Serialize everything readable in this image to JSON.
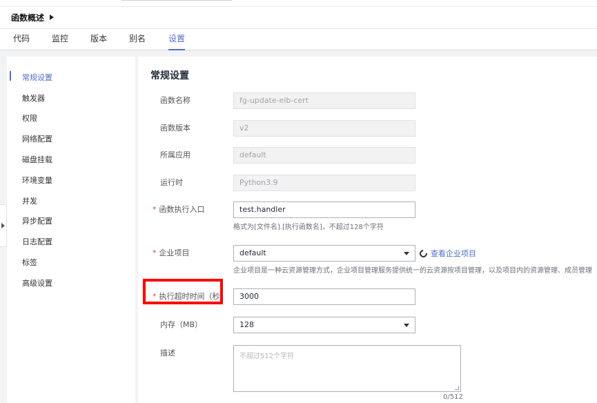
{
  "breadcrumb": {
    "title": "函数概述"
  },
  "tabs": [
    {
      "label": "代码"
    },
    {
      "label": "监控"
    },
    {
      "label": "版本"
    },
    {
      "label": "别名"
    },
    {
      "label": "设置"
    }
  ],
  "sidebar": {
    "items": [
      {
        "label": "常规设置"
      },
      {
        "label": "触发器"
      },
      {
        "label": "权限"
      },
      {
        "label": "网络配置"
      },
      {
        "label": "磁盘挂载"
      },
      {
        "label": "环境变量"
      },
      {
        "label": "并发"
      },
      {
        "label": "异步配置"
      },
      {
        "label": "日志配置"
      },
      {
        "label": "标签"
      },
      {
        "label": "高级设置"
      }
    ]
  },
  "section": {
    "title": "常规设置"
  },
  "form": {
    "function_name": {
      "label": "函数名称",
      "value": "fg-update-elb-cert"
    },
    "function_version": {
      "label": "函数版本",
      "value": "v2"
    },
    "app": {
      "label": "所属应用",
      "value": "default"
    },
    "runtime": {
      "label": "运行时",
      "value": "Python3.9"
    },
    "handler": {
      "label": "函数执行入口",
      "value": "test.handler",
      "hint": "格式为[文件名].[执行函数名]，不超过128个字符"
    },
    "enterprise_project": {
      "label": "企业项目",
      "value": "default",
      "link": "查看企业项目",
      "hint": "企业项目是一种云资源管理方式，企业项目管理服务提供统一的云资源按项目管理，以及项目内的资源管理、成员管理"
    },
    "timeout": {
      "label": "执行超时时间（秒）",
      "value": "3000"
    },
    "memory": {
      "label": "内存（MB）",
      "value": "128"
    },
    "description": {
      "label": "描述",
      "placeholder": "不超过512个字符",
      "counter": "0/512"
    }
  },
  "colors": {
    "accent": "#526ecc",
    "required": "#e54545",
    "highlight": "#ff0000"
  }
}
